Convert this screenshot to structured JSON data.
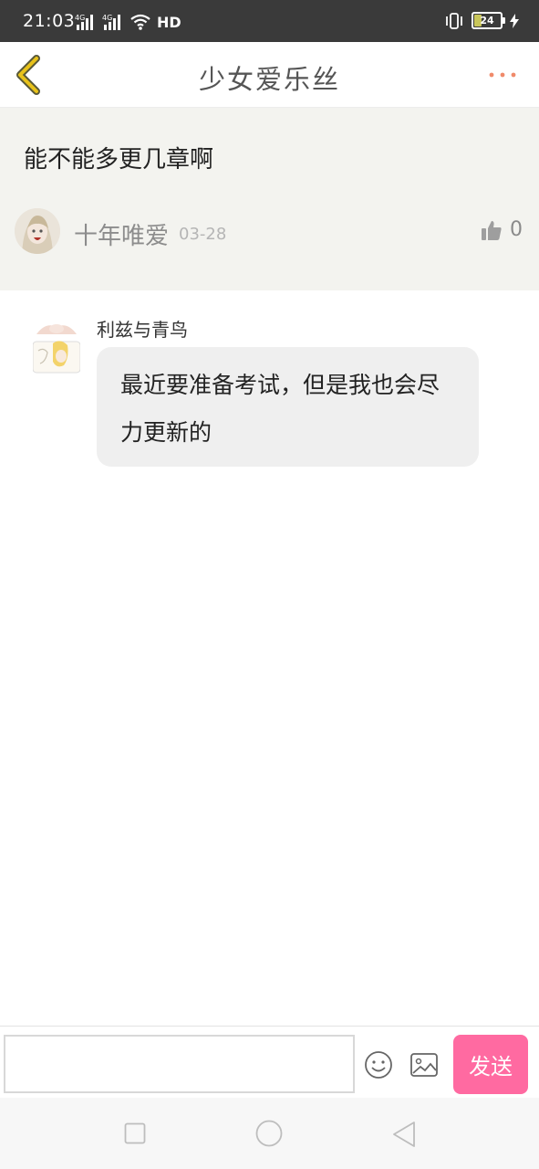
{
  "status_bar": {
    "time": "21:03",
    "network_1": "4G",
    "network_2": "4G",
    "hd_label": "HD",
    "battery_level": "24"
  },
  "header": {
    "title": "少女爱乐丝",
    "back_icon": "chevron-left-icon",
    "more_icon": "more-dots-icon",
    "accent_color": "#c9a400",
    "more_color": "#f08a6a"
  },
  "post": {
    "content": "能不能多更几章啊",
    "username": "十年唯爱",
    "date": "03-28",
    "like_count": "0"
  },
  "reply": {
    "username": "利兹与青鸟",
    "message": "最近要准备考试，但是我也会尽力更新的"
  },
  "input_bar": {
    "placeholder": "",
    "send_label": "发送",
    "send_color": "#ff6aa1"
  }
}
